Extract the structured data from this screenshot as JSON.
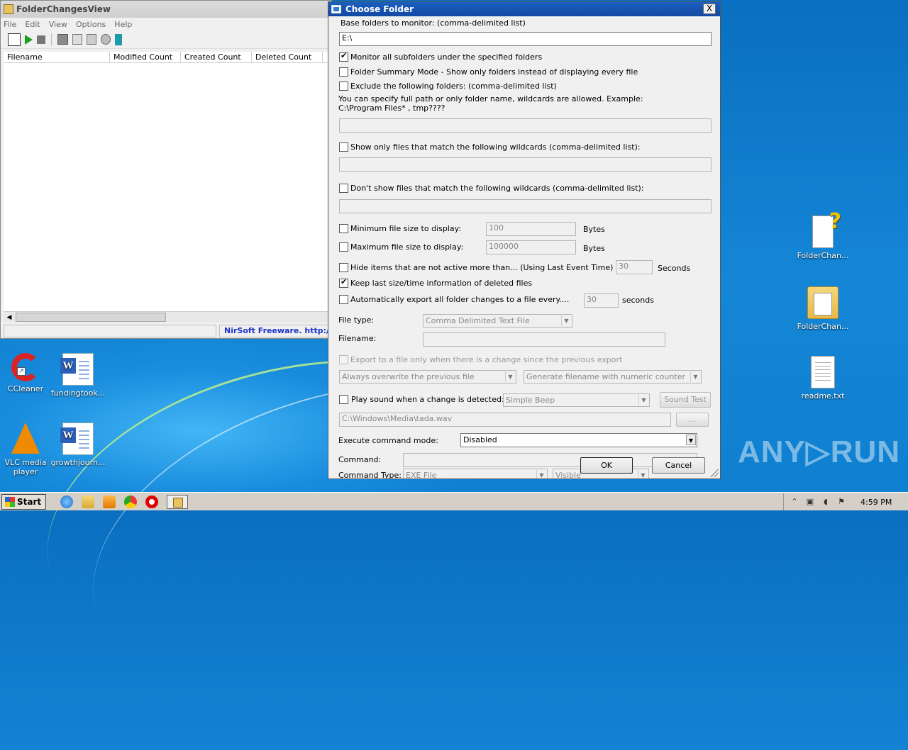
{
  "main_window": {
    "title": "FolderChangesView",
    "menu": [
      "File",
      "Edit",
      "View",
      "Options",
      "Help"
    ],
    "columns": [
      "Filename",
      "Modified Count",
      "Created Count",
      "Deleted Count"
    ],
    "status_right": "NirSoft Freeware.  http://www.nirsoft.net"
  },
  "dialog": {
    "title": "Choose Folder",
    "close_label": "X",
    "base_folders_label": "Base folders to monitor:  (comma-delimited list)",
    "base_folders_value": "E:\\",
    "monitor_subfolders": {
      "label": "Monitor all subfolders under the specified folders",
      "checked": true
    },
    "folder_summary": {
      "label": "Folder Summary Mode - Show only folders instead of displaying every file",
      "checked": false
    },
    "exclude_folders": {
      "label": "Exclude the following folders: (comma-delimited list)",
      "checked": false
    },
    "exclude_hint_1": "You can specify full path or only folder name, wildcards are allowed. Example:",
    "exclude_hint_2": "C:\\Program Files* , tmp????",
    "exclude_value": "",
    "show_only_wildcards": {
      "label": "Show only files that match the following wildcards (comma-delimited list):",
      "checked": false
    },
    "show_only_value": "",
    "dont_show_wildcards": {
      "label": "Don't show files that match the following wildcards (comma-delimited list):",
      "checked": false
    },
    "dont_show_value": "",
    "min_size": {
      "label": "Minimum file size to display:",
      "value": "100",
      "unit": "Bytes",
      "checked": false
    },
    "max_size": {
      "label": "Maximum file size to display:",
      "value": "100000",
      "unit": "Bytes",
      "checked": false
    },
    "hide_inactive": {
      "label": "Hide items that are not active more than... (Using Last Event Time)",
      "value": "30",
      "unit": "Seconds",
      "checked": false
    },
    "keep_last": {
      "label": "Keep last size/time information of deleted files",
      "checked": true
    },
    "auto_export": {
      "label": "Automatically export all folder changes to a file every....",
      "value": "30",
      "unit": "seconds",
      "checked": false
    },
    "file_type_label": "File type:",
    "file_type_value": "Comma Delimited Text File",
    "filename_label": "Filename:",
    "filename_value": "",
    "export_only_change": {
      "label": "Export to a file only when there is a change since the previous export",
      "checked": false
    },
    "overwrite_value": "Always overwrite the previous file",
    "generate_value": "Generate filename with numeric counter",
    "play_sound": {
      "label": "Play sound when a change is detected:",
      "checked": false
    },
    "sound_value": "Simple Beep",
    "sound_test_label": "Sound Test",
    "sound_path_value": "C:\\Windows\\Media\\tada.wav",
    "browse_label": "...",
    "exec_mode_label": "Execute command mode:",
    "exec_mode_value": "Disabled",
    "command_label": "Command:",
    "command_value": "",
    "command_type_label": "Command Type:",
    "command_type_value": "EXE File",
    "command_visibility_value": "Visible",
    "ok_label": "OK",
    "cancel_label": "Cancel"
  },
  "desktop": {
    "icons_left": [
      {
        "label": "CCleaner"
      },
      {
        "label": "fundingtook..."
      },
      {
        "label": "VLC media player"
      },
      {
        "label": "growthjourn..."
      }
    ],
    "icons_right": [
      {
        "label": "FolderChan..."
      },
      {
        "label": "FolderChan..."
      },
      {
        "label": "readme.txt"
      }
    ],
    "watermark": "ANY▷RUN"
  },
  "taskbar": {
    "start_label": "Start",
    "clock": "4:59 PM"
  }
}
